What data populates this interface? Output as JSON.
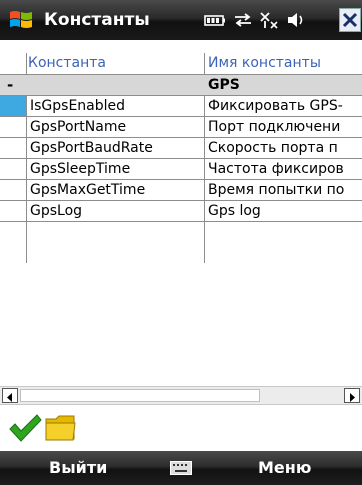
{
  "titlebar": {
    "title": "Константы"
  },
  "grid": {
    "columns": [
      "Константа",
      "Имя константы"
    ],
    "group": {
      "toggle": "-",
      "name": "GPS"
    },
    "rows": [
      {
        "key": "IsGpsEnabled",
        "name": "Фиксировать GPS-"
      },
      {
        "key": "GpsPortName",
        "name": "Порт подключени"
      },
      {
        "key": "GpsPortBaudRate",
        "name": "Скорость порта п"
      },
      {
        "key": "GpsSleepTime",
        "name": "Частота фиксиров"
      },
      {
        "key": "GpsMaxGetTime",
        "name": "Время попытки по"
      },
      {
        "key": "GpsLog",
        "name": "Gps log"
      }
    ]
  },
  "softkeys": {
    "left": "Выйти",
    "right": "Меню"
  },
  "icons": {
    "start": "windows-flag-icon",
    "battery": "battery-icon",
    "sync": "sync-arrows-icon",
    "signal": "signal-off-icon",
    "volume": "speaker-icon",
    "ok": "checkmark-icon",
    "folder": "folder-icon",
    "keyboard": "keyboard-icon"
  },
  "colors": {
    "header_text": "#3b63b7",
    "selection": "#3da9e0",
    "group_row": "#d7d7d7"
  }
}
